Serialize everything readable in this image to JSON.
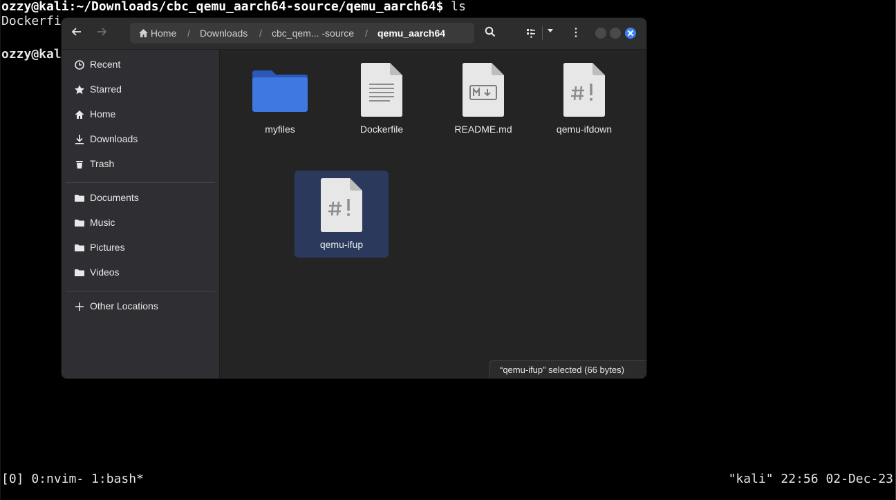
{
  "terminal": {
    "prompt1_user": "ozzy@kali",
    "prompt1_path": ":~/Downloads/cbc_qemu_aarch64-source/qemu_aarch64$",
    "prompt1_cmd": " ls",
    "line2": "Dockerfi",
    "prompt2_user": "ozzy@kal",
    "tmux_left": "[0] 0:nvim- 1:bash*",
    "tmux_right": "\"kali\" 22:56 02-Dec-23"
  },
  "window": {
    "back_icon": "arrow-left-icon",
    "forward_icon": "arrow-right-icon",
    "breadcrumb": {
      "home": "Home",
      "downloads": "Downloads",
      "source": "cbc_qem... -source",
      "current": "qemu_aarch64"
    },
    "status": "“qemu-ifup” selected  (66 bytes)"
  },
  "sidebar": {
    "items": [
      {
        "label": "Recent",
        "icon": "clock-icon"
      },
      {
        "label": "Starred",
        "icon": "star-icon"
      },
      {
        "label": "Home",
        "icon": "home-icon"
      },
      {
        "label": "Downloads",
        "icon": "download-icon"
      },
      {
        "label": "Trash",
        "icon": "trash-icon"
      },
      {
        "label": "Documents",
        "icon": "folder-icon"
      },
      {
        "label": "Music",
        "icon": "folder-icon"
      },
      {
        "label": "Pictures",
        "icon": "folder-icon"
      },
      {
        "label": "Videos",
        "icon": "folder-icon"
      },
      {
        "label": "Other Locations",
        "icon": "plus-icon"
      }
    ]
  },
  "files": [
    {
      "name": "myfiles",
      "type": "folder"
    },
    {
      "name": "Dockerfile",
      "type": "text"
    },
    {
      "name": "README.md",
      "type": "markdown"
    },
    {
      "name": "qemu-ifdown",
      "type": "script"
    },
    {
      "name": "qemu-ifup",
      "type": "script",
      "selected": true
    }
  ],
  "colors": {
    "accent": "#3b82f6",
    "folder": "#3f6fd8",
    "selection": "#2b3a5c"
  }
}
